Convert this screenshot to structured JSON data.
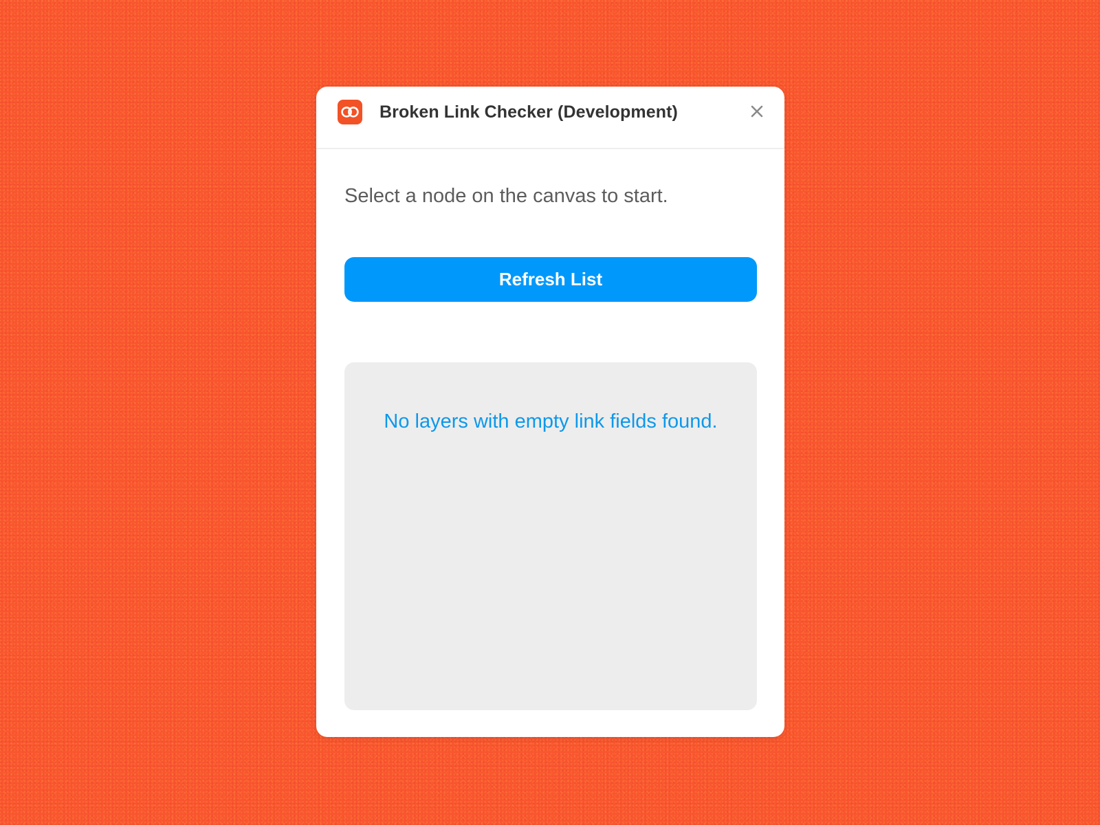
{
  "theme": {
    "background": "#f9552f",
    "accent": "#0098fa",
    "message_color": "#0e98ea",
    "app_icon_color": "#f25226"
  },
  "window": {
    "title": "Broken Link Checker (Development)",
    "app_icon": "link-chain-icon",
    "close_icon": "close-icon"
  },
  "main": {
    "instruction": "Select a node on the canvas to start.",
    "refresh_label": "Refresh List",
    "results": {
      "empty_message": "No layers with empty link fields found."
    }
  }
}
